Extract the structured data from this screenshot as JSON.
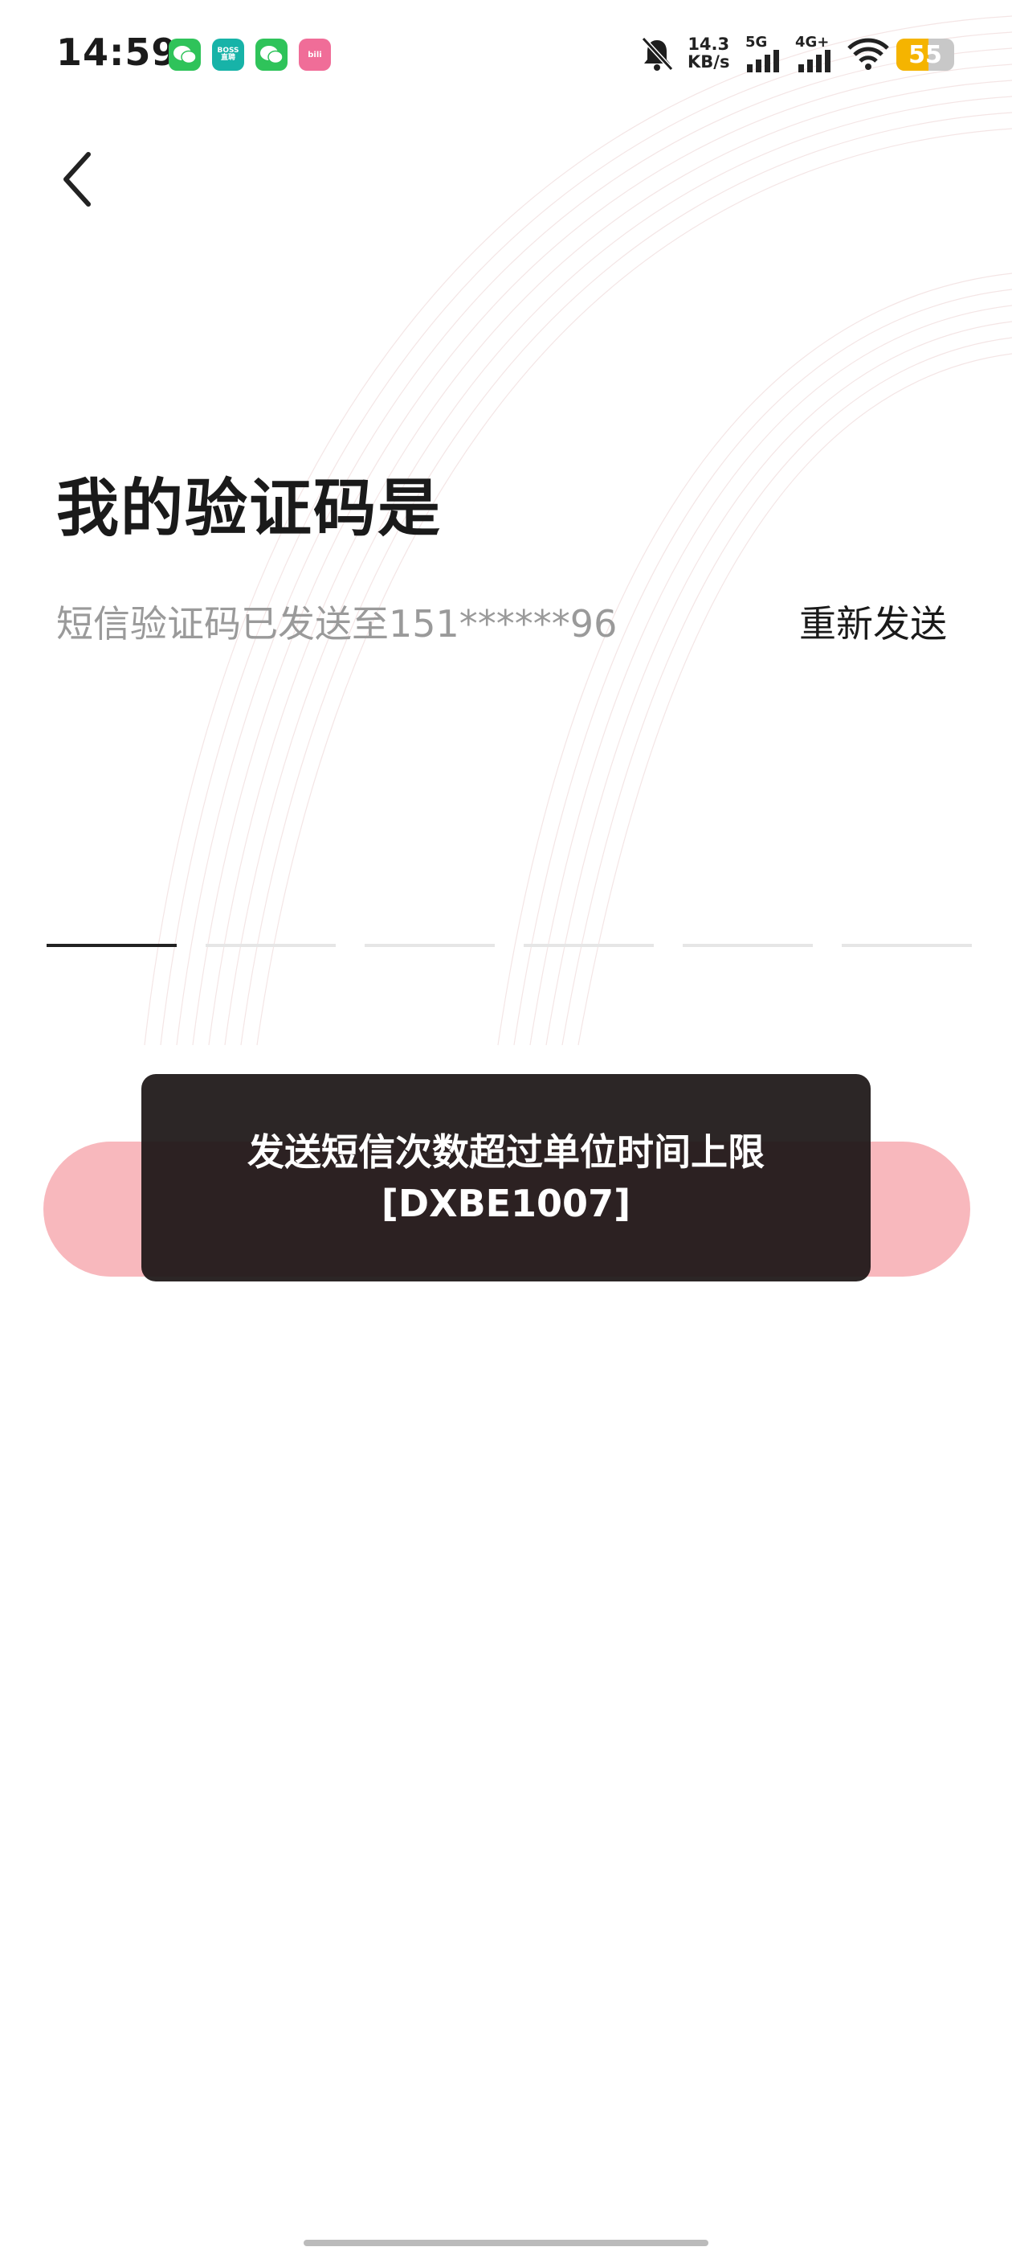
{
  "status_bar": {
    "time": "14:59",
    "notification_icons": [
      "wechat-icon",
      "boss-zhipin-icon",
      "wechat-icon",
      "bilibili-icon"
    ],
    "boss_icon_text": "BOSS\n直聘",
    "bili_icon_text": "bili",
    "net_speed_value": "14.3",
    "net_speed_unit": "KB/s",
    "network_5g": "5G",
    "network_4g": "4G+",
    "battery_level": "55",
    "battery_fraction": 0.55,
    "battery_color": "#f5b400"
  },
  "header": {
    "back_icon": "chevron-left-icon"
  },
  "main": {
    "title": "我的验证码是",
    "subtitle": "短信验证码已发送至151******96",
    "resend_label": "重新发送",
    "code_slots": 6,
    "active_slot": 0
  },
  "toast": {
    "line1": "发送短信次数超过单位时间上限",
    "line2": "[DXBE1007]"
  },
  "colors": {
    "accent_button": "#f8b8bd",
    "toast_bg": "#1c1616"
  }
}
